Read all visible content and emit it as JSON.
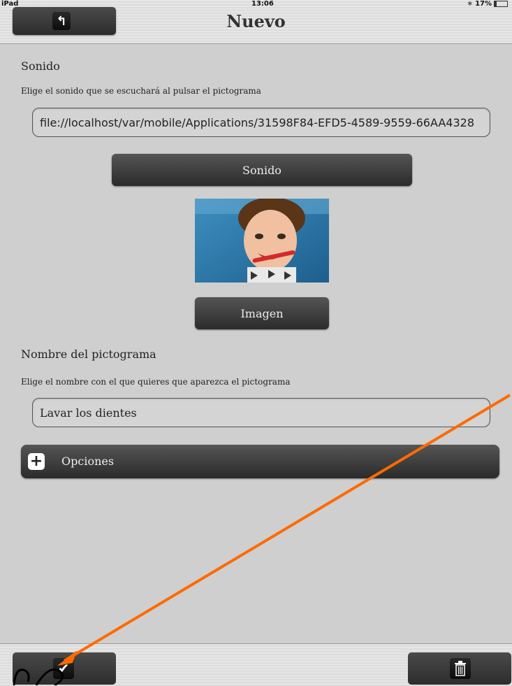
{
  "status": {
    "carrier": "iPad",
    "time": "13:06",
    "battery": "17%"
  },
  "nav": {
    "title": "Nuevo",
    "back_icon": "back-arrow-icon"
  },
  "sound": {
    "section_title": "Sonido",
    "description": "Elige el sonido que se escuchará al pulsar el pictograma",
    "file_value": "file://localhost/var/mobile/Applications/31598F84-EFD5-4589-9559-66AA4328",
    "button_label": "Sonido"
  },
  "image": {
    "button_label": "Imagen"
  },
  "name": {
    "section_title": "Nombre del pictograma",
    "description": "Elige el nombre con el que quieres que aparezca el pictograma",
    "field_value": "Lavar los dientes"
  },
  "options": {
    "label": "Opciones",
    "icon": "plus-icon"
  },
  "bottom": {
    "confirm_icon": "check-icon",
    "delete_icon": "trash-icon"
  },
  "colors": {
    "annotation_arrow": "#ff6a00",
    "background": "#cfcfcf"
  }
}
